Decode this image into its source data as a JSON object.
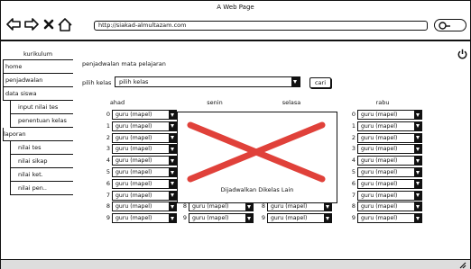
{
  "window": {
    "title": "A Web Page"
  },
  "browser": {
    "url": "http://siakad-almultazam.com"
  },
  "sidebar": {
    "header": "kurikulum",
    "items": [
      {
        "label": "home",
        "type": "top"
      },
      {
        "label": "penjadwalan",
        "type": "top"
      },
      {
        "label": "data siswa",
        "type": "top"
      },
      {
        "label": "input nilai tes",
        "type": "sub"
      },
      {
        "label": "penentuan kelas",
        "type": "sub"
      },
      {
        "label": "laporan",
        "type": "flush"
      },
      {
        "label": "nilai tes",
        "type": "sub"
      },
      {
        "label": "nilai sikap",
        "type": "sub"
      },
      {
        "label": "nilai ket.",
        "type": "sub"
      },
      {
        "label": "nilai pen..",
        "type": "sub"
      }
    ]
  },
  "main": {
    "title": "penjadwalan mata pelajaran",
    "kelas_label": "pilih kelas",
    "kelas_value": "pilih kelas",
    "cari_label": "cari",
    "days": [
      "ahad",
      "senin",
      "selasa",
      "rabu"
    ],
    "dropdown_value": "guru (mapel)",
    "slots": [
      "0",
      "1",
      "2",
      "3",
      "4",
      "5",
      "6",
      "7",
      "8",
      "9"
    ],
    "overlay_message": "Dijadwalkan Dikelas Lain"
  }
}
